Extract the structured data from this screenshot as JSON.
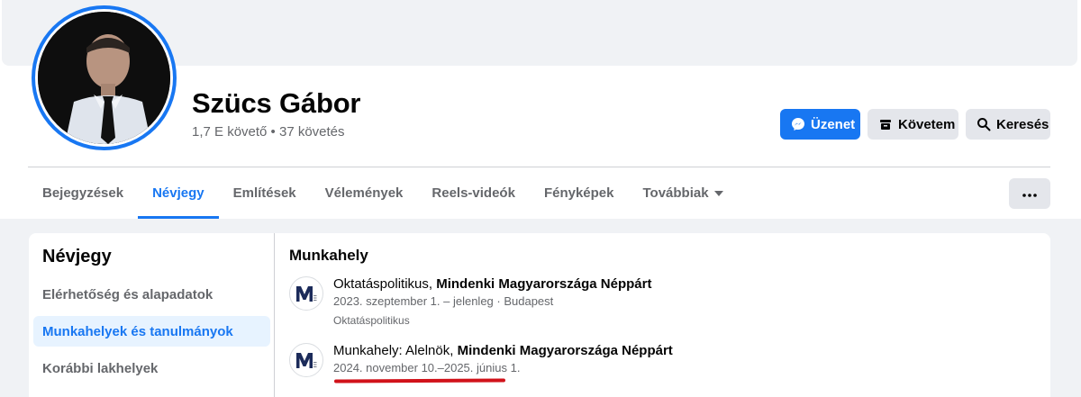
{
  "profile": {
    "name": "Szücs Gábor",
    "followers": "1,7 E követő • 37 követés"
  },
  "actions": {
    "message_label": "Üzenet",
    "follow_label": "Követem",
    "search_label": "Keresés"
  },
  "tabs": [
    {
      "label": "Bejegyzések"
    },
    {
      "label": "Névjegy"
    },
    {
      "label": "Említések"
    },
    {
      "label": "Vélemények"
    },
    {
      "label": "Reels-videók"
    },
    {
      "label": "Fényképek"
    },
    {
      "label": "Továbbiak"
    }
  ],
  "sidebar": {
    "title": "Névjegy",
    "items": [
      {
        "label": "Elérhetőség és alapadatok"
      },
      {
        "label": "Munkahelyek és tanulmányok"
      },
      {
        "label": "Korábbi lakhelyek"
      }
    ]
  },
  "main": {
    "section_title": "Munkahely",
    "jobs": [
      {
        "role": "Oktatáspolitikus, ",
        "org": "Mindenki Magyarországa Néppárt",
        "meta": "2023. szeptember 1. – jelenleg · Budapest",
        "desc": "Oktatáspolitikus"
      },
      {
        "role": "Munkahely: Alelnök, ",
        "org": "Mindenki Magyarországa Néppárt",
        "meta": "2024. november 10.–2025. június 1."
      }
    ]
  },
  "colors": {
    "accent": "#1877f2",
    "annotation_underline": "#d1121a"
  }
}
